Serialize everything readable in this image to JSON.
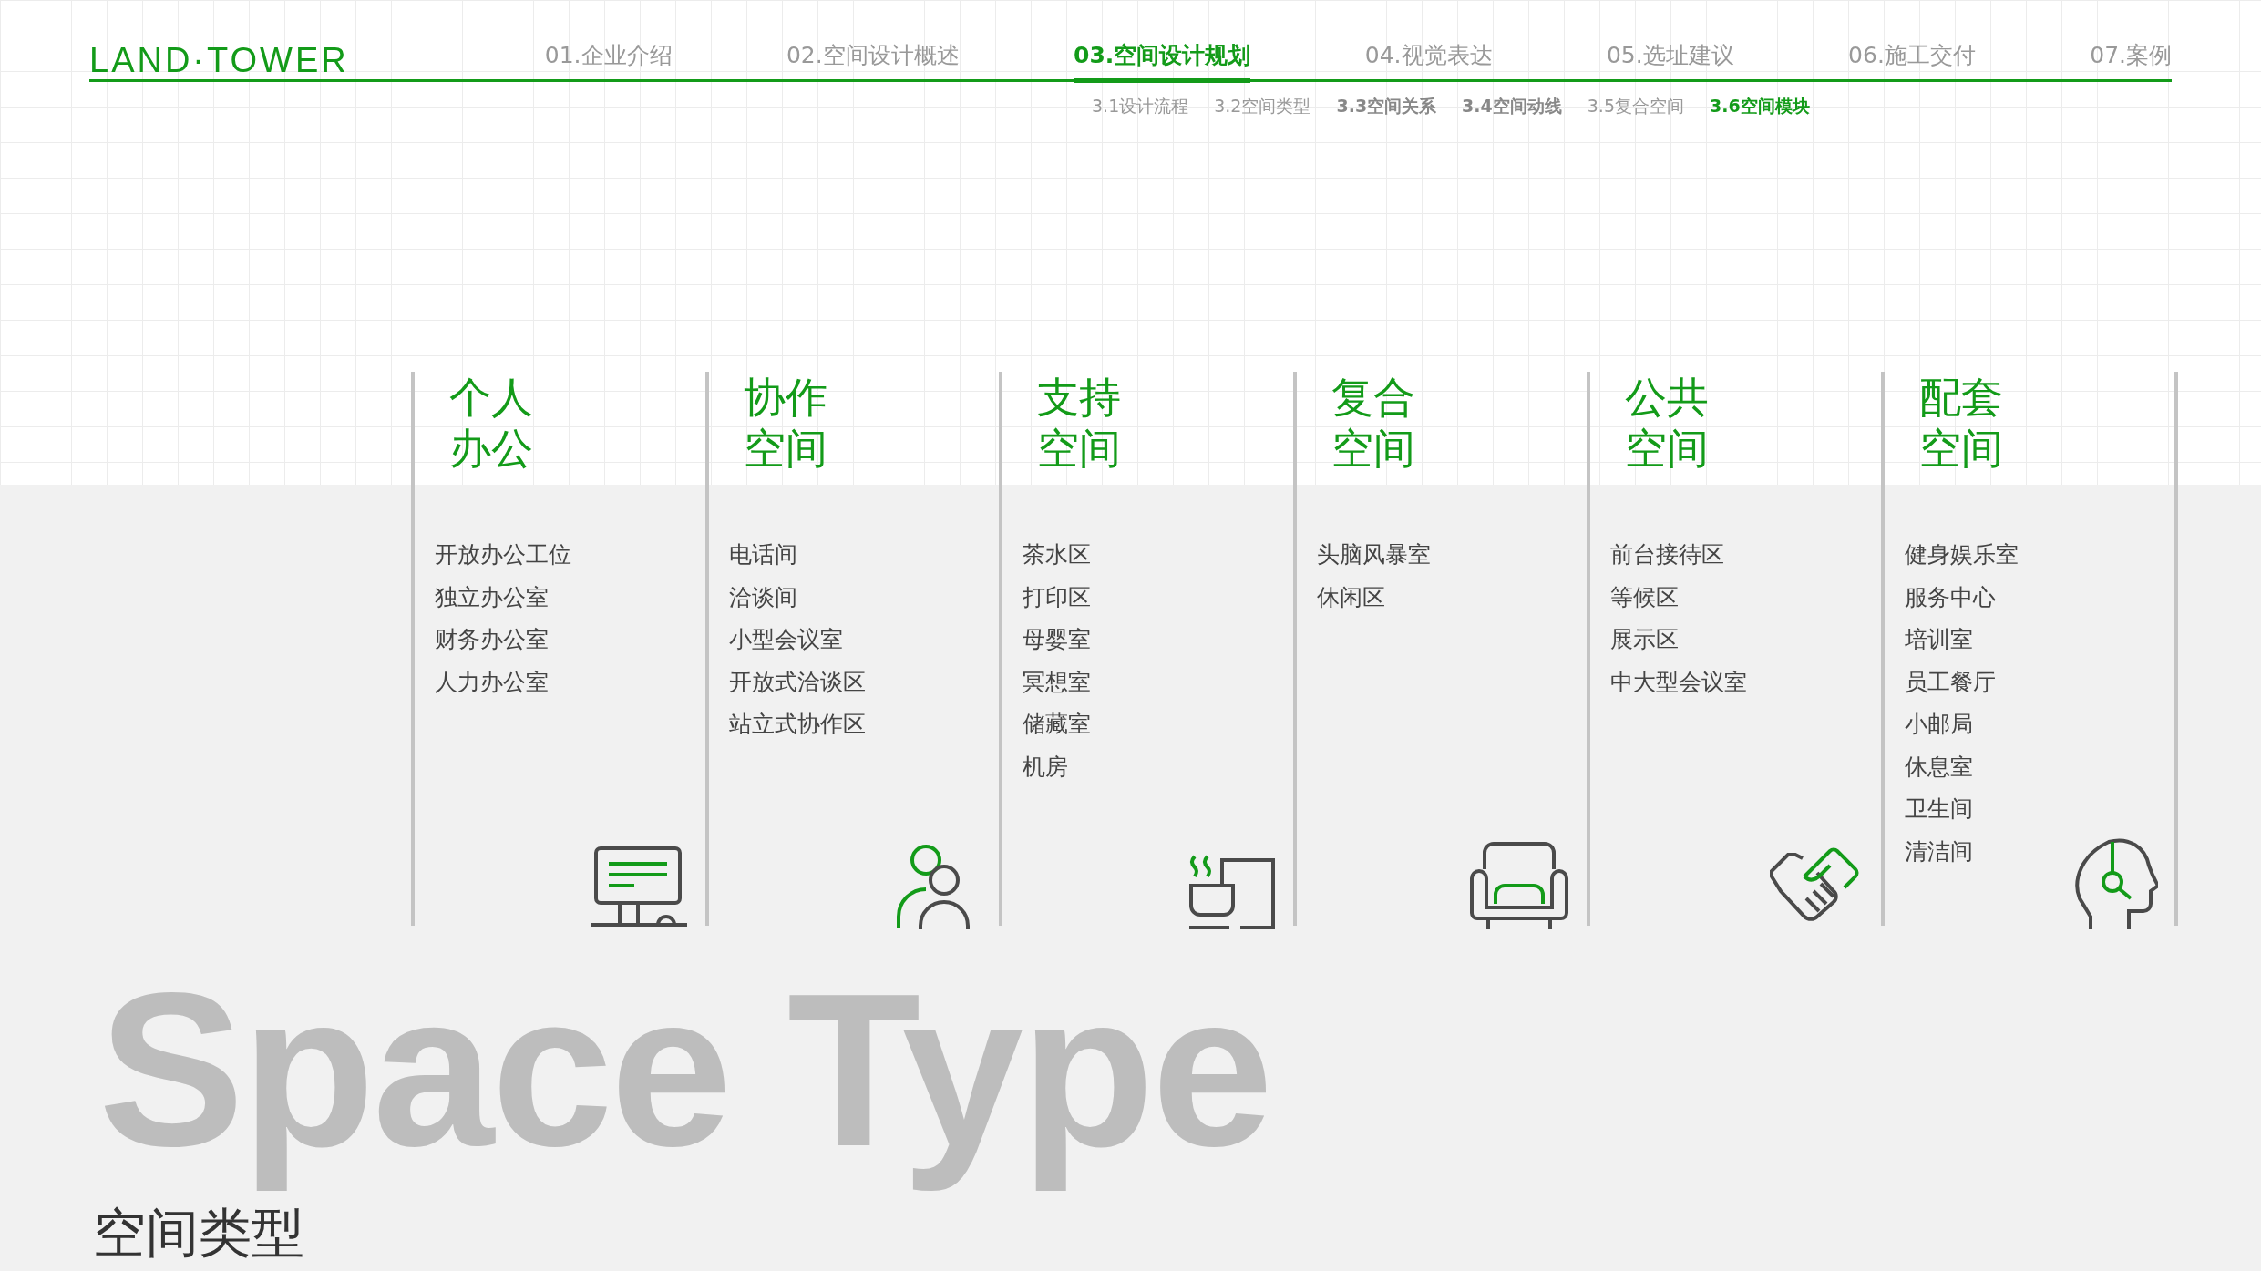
{
  "logo": "LAND·TOWER",
  "nav": [
    {
      "label": "01.企业介绍",
      "selected": false
    },
    {
      "label": "02.空间设计概述",
      "selected": false
    },
    {
      "label": "03.空间设计规划",
      "selected": true
    },
    {
      "label": "04.视觉表达",
      "selected": false
    },
    {
      "label": "05.选址建议",
      "selected": false
    },
    {
      "label": "06.施工交付",
      "selected": false
    },
    {
      "label": "07.案例",
      "selected": false
    }
  ],
  "subnav": [
    {
      "label": "3.1设计流程",
      "bold": false,
      "selected": false
    },
    {
      "label": "3.2空间类型",
      "bold": false,
      "selected": false
    },
    {
      "label": "3.3空间关系",
      "bold": true,
      "selected": false
    },
    {
      "label": "3.4空间动线",
      "bold": true,
      "selected": false
    },
    {
      "label": "3.5复合空间",
      "bold": false,
      "selected": false
    },
    {
      "label": "3.6空间模块",
      "bold": true,
      "selected": true
    }
  ],
  "columns": [
    {
      "title": [
        "个人",
        "办公"
      ],
      "items": [
        "开放办公工位",
        "独立办公室",
        "财务办公室",
        "人力办公室"
      ]
    },
    {
      "title": [
        "协作",
        "空间"
      ],
      "items": [
        "电话间",
        "洽谈间",
        "小型会议室",
        "开放式洽谈区",
        "站立式协作区"
      ]
    },
    {
      "title": [
        "支持",
        "空间"
      ],
      "items": [
        "茶水区",
        "打印区",
        "母婴室",
        "冥想室",
        "储藏室",
        "机房"
      ]
    },
    {
      "title": [
        "复合",
        "空间"
      ],
      "items": [
        "头脑风暴室",
        "休闲区"
      ]
    },
    {
      "title": [
        "公共",
        "空间"
      ],
      "items": [
        "前台接待区",
        "等候区",
        "展示区",
        "中大型会议室"
      ]
    },
    {
      "title": [
        "配套",
        "空间"
      ],
      "items": [
        "健身娱乐室",
        "服务中心",
        "培训室",
        "员工餐厅",
        "小邮局",
        "休息室",
        "卫生间",
        "清洁间"
      ]
    }
  ],
  "backdrop_text": "Space Type",
  "page_title": "空间类型"
}
